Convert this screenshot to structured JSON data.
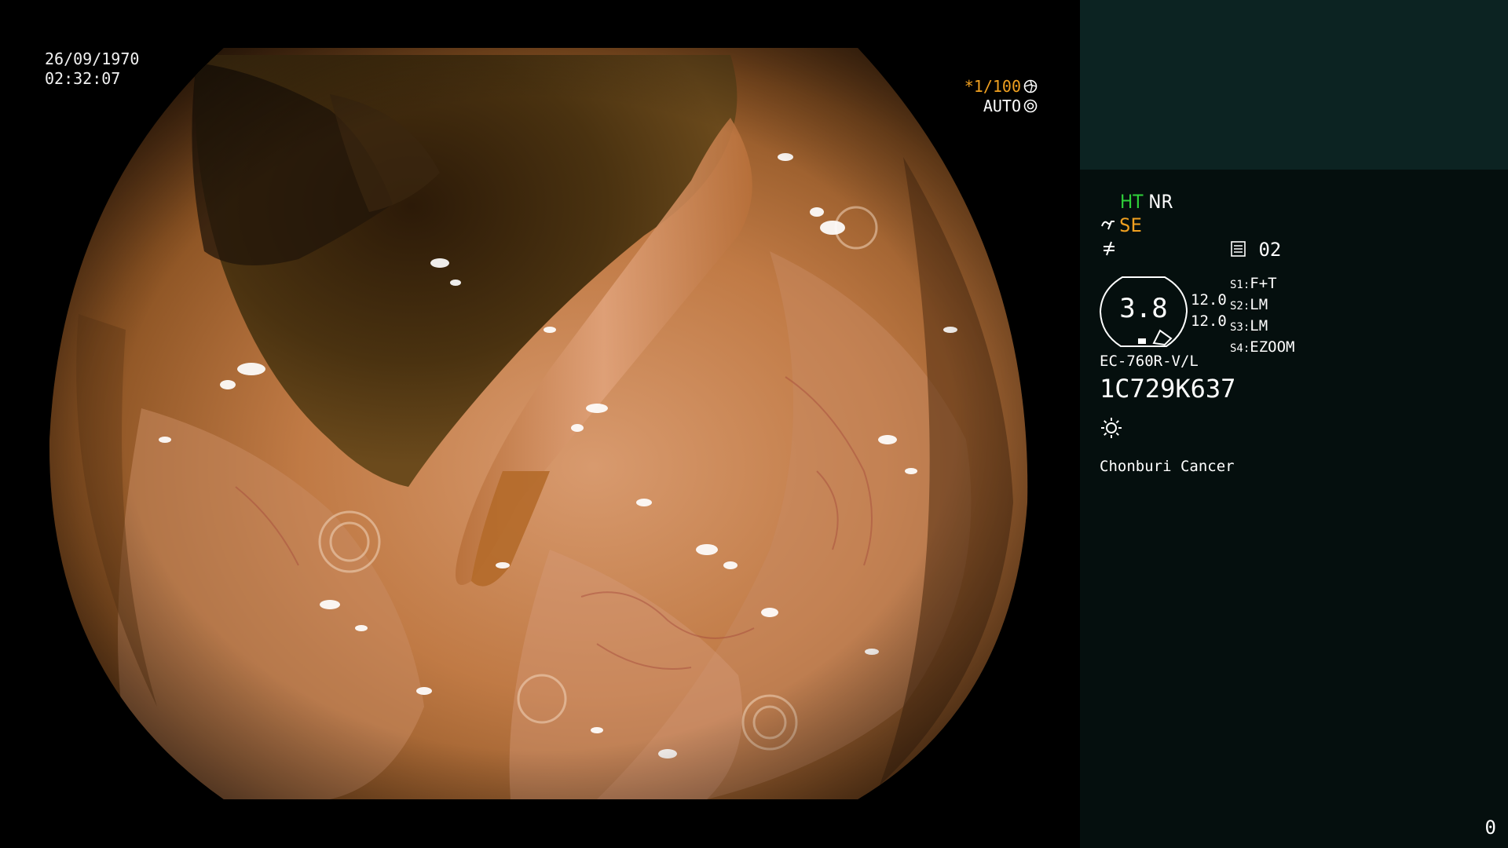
{
  "viewport": {
    "date": "26/09/1970",
    "time": "02:32:07",
    "shutter_speed": "*1/100",
    "iris_mode": "AUTO"
  },
  "panel": {
    "ht": "HT",
    "nr": "NR",
    "se": "SE",
    "store_number": "02",
    "scale_value": "3.8",
    "scale_upper": "12.0",
    "scale_lower": "12.0",
    "switches": [
      {
        "key": "S1:",
        "value": "F+T"
      },
      {
        "key": "S2:",
        "value": "LM"
      },
      {
        "key": "S3:",
        "value": "LM"
      },
      {
        "key": "S4:",
        "value": "EZOOM"
      }
    ],
    "scope_model": "EC-760R-V/L",
    "scope_serial": "1C729K637",
    "institution": "Chonburi Cancer",
    "counter": "0"
  },
  "colors": {
    "accent_green": "#2fd23a",
    "accent_orange": "#f0a020",
    "panel_bg": "#050f0e",
    "panel_top_bg": "#0c2322"
  },
  "icons": {
    "shutter": "aperture-icon",
    "iris": "iris-icon",
    "se": "enhance-wave-icon",
    "mode": "mode-slash-icon",
    "store": "memory-card-icon",
    "light": "sun-light-icon"
  }
}
